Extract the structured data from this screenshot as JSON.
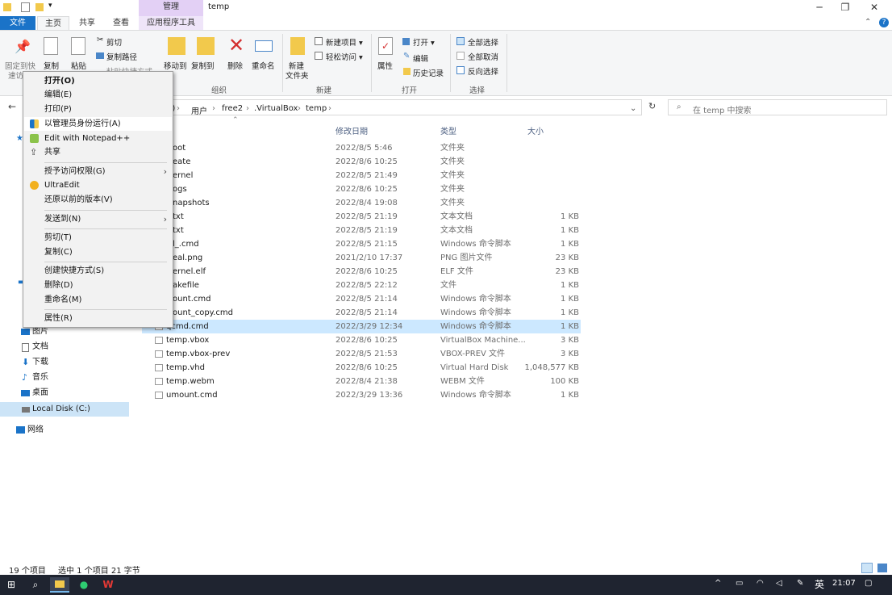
{
  "window": {
    "title": "temp",
    "context_tab_header": "管理",
    "minimize": "─",
    "maximize": "❐",
    "close": "✕"
  },
  "tabs": [
    "文件",
    "主页",
    "共享",
    "查看",
    "应用程序工具"
  ],
  "ribbon": {
    "pin": "固定到快\n速访",
    "copy": "复制",
    "paste": "粘贴",
    "cut": "剪切",
    "copy_path": "复制路径",
    "paste_shortcut": "粘贴快捷方式",
    "move_to": "移动到",
    "copy_to": "复制到",
    "delete": "删除",
    "rename": "重命名",
    "group_organize": "组织",
    "new_folder_1": "新建",
    "new_folder_2": "文件夹",
    "new_item": "新建项目 ▾",
    "easy_access": "轻松访问 ▾",
    "group_new": "新建",
    "properties": "属性",
    "open": "打开 ▾",
    "edit": "编辑",
    "history": "历史记录",
    "group_open": "打开",
    "select_all": "全部选择",
    "select_none": "全部取消",
    "invert_selection": "反向选择",
    "group_select": "选择"
  },
  "address": {
    "breadcrumb": [
      "C:)",
      "用户",
      "free2",
      ".VirtualBox",
      "temp"
    ],
    "search_placeholder": "在 temp 中搜索"
  },
  "columns": {
    "date": "修改日期",
    "type": "类型",
    "size": "大小"
  },
  "files": [
    {
      "name": "oot",
      "date": "2022/8/5 5:46",
      "type": "文件夹",
      "size": ""
    },
    {
      "name": "eate",
      "date": "2022/8/6 10:25",
      "type": "文件夹",
      "size": ""
    },
    {
      "name": "ernel",
      "date": "2022/8/5 21:49",
      "type": "文件夹",
      "size": ""
    },
    {
      "name": "ogs",
      "date": "2022/8/6 10:25",
      "type": "文件夹",
      "size": ""
    },
    {
      "name": "napshots",
      "date": "2022/8/4 19:08",
      "type": "文件夹",
      "size": ""
    },
    {
      "name": "txt",
      "date": "2022/8/5 21:19",
      "type": "文本文档",
      "size": "1 KB"
    },
    {
      "name": "txt",
      "date": "2022/8/5 21:19",
      "type": "文本文档",
      "size": "1 KB"
    },
    {
      "name": "l_.cmd",
      "date": "2022/8/5 21:15",
      "type": "Windows 命令脚本",
      "size": "1 KB"
    },
    {
      "name": "eal.png",
      "date": "2021/2/10 17:37",
      "type": "PNG 图片文件",
      "size": "23 KB"
    },
    {
      "name": "ernel.elf",
      "date": "2022/8/6 10:25",
      "type": "ELF 文件",
      "size": "23 KB"
    },
    {
      "name": "akefile",
      "date": "2022/8/5 22:12",
      "type": "文件",
      "size": "1 KB"
    },
    {
      "name": "ount.cmd",
      "date": "2022/8/5 21:14",
      "type": "Windows 命令脚本",
      "size": "1 KB"
    },
    {
      "name": "ount_copy.cmd",
      "date": "2022/8/5 21:14",
      "type": "Windows 命令脚本",
      "size": "1 KB"
    },
    {
      "name": "qcmd.cmd",
      "date": "2022/3/29 12:34",
      "type": "Windows 命令脚本",
      "size": "1 KB"
    },
    {
      "name": "temp.vbox",
      "date": "2022/8/6 10:25",
      "type": "VirtualBox Machine...",
      "size": "3 KB"
    },
    {
      "name": "temp.vbox-prev",
      "date": "2022/8/5 21:53",
      "type": "VBOX-PREV 文件",
      "size": "3 KB"
    },
    {
      "name": "temp.vhd",
      "date": "2022/8/6 10:25",
      "type": "Virtual Hard Disk",
      "size": "1,048,577 KB"
    },
    {
      "name": "temp.webm",
      "date": "2022/8/4 21:38",
      "type": "WEBM 文件",
      "size": "100 KB"
    },
    {
      "name": "umount.cmd",
      "date": "2022/3/29 13:36",
      "type": "Windows 命令脚本",
      "size": "1 KB"
    }
  ],
  "nav": {
    "pictures": "图片",
    "documents": "文档",
    "downloads": "下载",
    "music": "音乐",
    "desktop": "桌面",
    "local_disk": "Local Disk (C:)",
    "network": "网络"
  },
  "menu": {
    "open": "打开(O)",
    "edit": "编辑(E)",
    "print": "打印(P)",
    "run_as_admin": "以管理员身份运行(A)",
    "edit_notepad": "Edit with Notepad++",
    "share": "共享",
    "grant_access": "授予访问权限(G)",
    "ultraedit": "UltraEdit",
    "restore_versions": "还原以前的版本(V)",
    "send_to": "发送到(N)",
    "cut": "剪切(T)",
    "copy": "复制(C)",
    "create_shortcut": "创建快捷方式(S)",
    "delete": "删除(D)",
    "rename": "重命名(M)",
    "properties": "属性(R)"
  },
  "status": {
    "count": "19 个项目",
    "selected": "选中 1 个项目  21 字节"
  },
  "taskbar": {
    "lang": "英",
    "time": "21:07"
  },
  "colors": {
    "accent": "#1a73c8",
    "selection": "#cce8ff",
    "context_tab": "#e3d0f5"
  }
}
